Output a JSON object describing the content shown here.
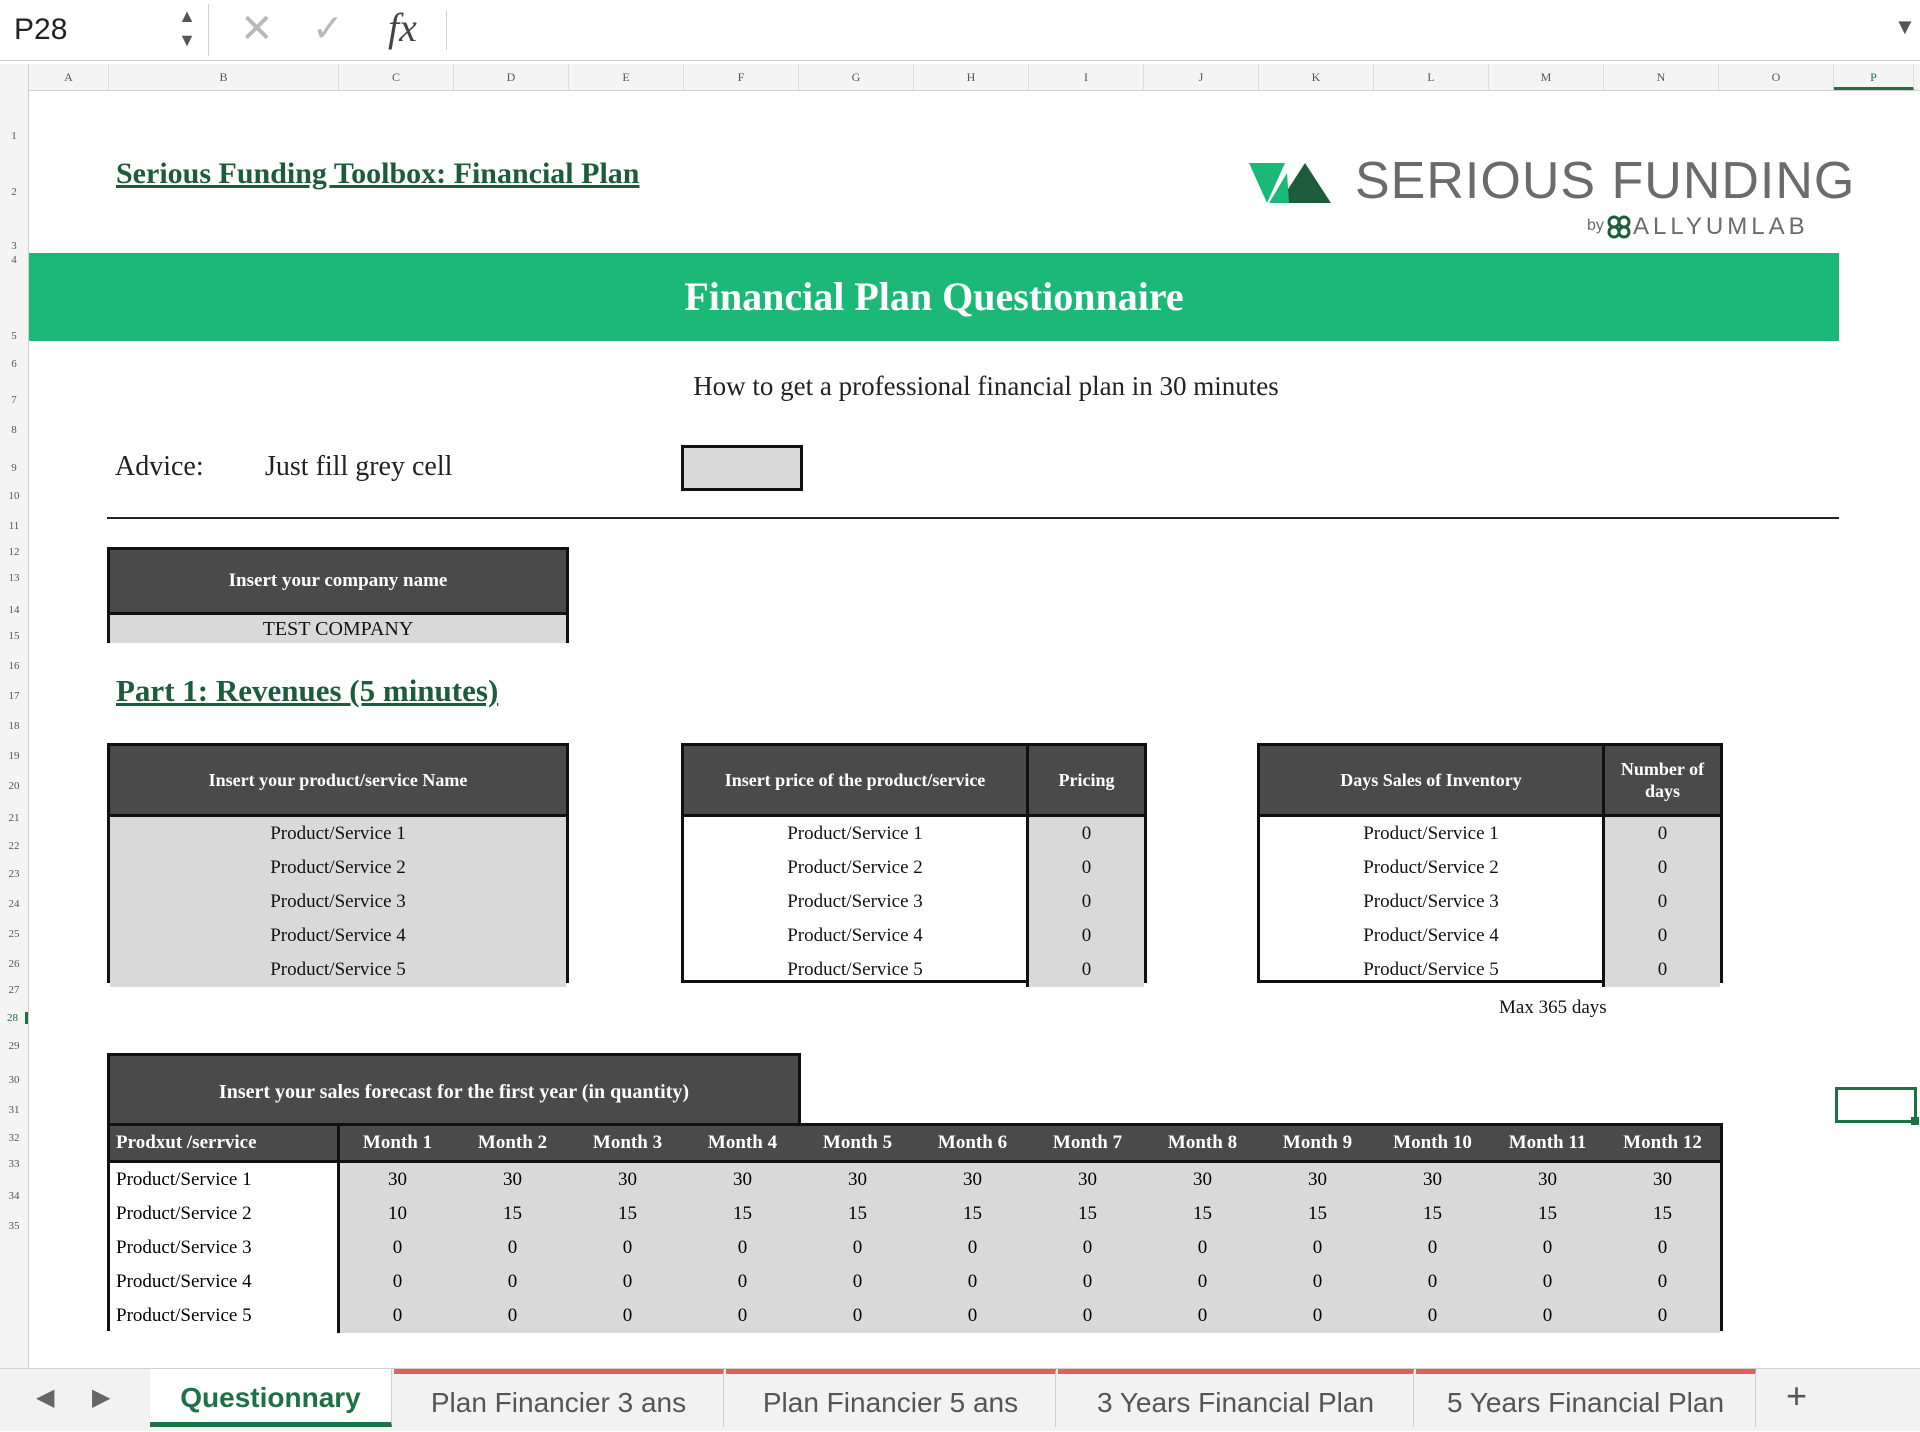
{
  "formula_bar": {
    "name_box": "P28",
    "cancel_icon": "✕",
    "enter_icon": "✓",
    "fx_label": "fx",
    "formula": ""
  },
  "columns": [
    "A",
    "B",
    "C",
    "D",
    "E",
    "F",
    "G",
    "H",
    "I",
    "J",
    "K",
    "L",
    "M",
    "N",
    "O",
    "P"
  ],
  "rows": [
    "1",
    "2",
    "3",
    "4",
    "5",
    "6",
    "7",
    "8",
    "9",
    "10",
    "11",
    "12",
    "13",
    "14",
    "15",
    "16",
    "17",
    "18",
    "19",
    "20",
    "21",
    "22",
    "23",
    "24",
    "25",
    "26",
    "27",
    "28",
    "29",
    "30",
    "31",
    "32",
    "33",
    "34",
    "35"
  ],
  "sheet": {
    "title": "Serious Funding Toolbox: Financial Plan",
    "logo": {
      "name": "SERIOUS FUNDING",
      "by": "by",
      "sub": "ALLYUMLAB"
    },
    "banner": "Financial Plan Questionnaire",
    "subtitle": "How to get a professional financial plan in 30 minutes",
    "advice_label": "Advice:",
    "advice_text": "Just fill grey cell",
    "company": {
      "header": "Insert your company name",
      "value": "TEST COMPANY"
    },
    "part1": "Part 1: Revenues (5 minutes)",
    "names_table": {
      "header": "Insert your product/service Name",
      "items": [
        "Product/Service 1",
        "Product/Service 2",
        "Product/Service 3",
        "Product/Service 4",
        "Product/Service 5"
      ]
    },
    "price_table": {
      "header": "Insert price of the product/service",
      "value_header": "Pricing",
      "rows": [
        {
          "name": "Product/Service 1",
          "value": "0"
        },
        {
          "name": "Product/Service 2",
          "value": "0"
        },
        {
          "name": "Product/Service 3",
          "value": "0"
        },
        {
          "name": "Product/Service 4",
          "value": "0"
        },
        {
          "name": "Product/Service 5",
          "value": "0"
        }
      ]
    },
    "inventory_table": {
      "header": "Days Sales of Inventory",
      "value_header": "Number of days",
      "rows": [
        {
          "name": "Product/Service 1",
          "value": "0"
        },
        {
          "name": "Product/Service 2",
          "value": "0"
        },
        {
          "name": "Product/Service 3",
          "value": "0"
        },
        {
          "name": "Product/Service 4",
          "value": "0"
        },
        {
          "name": "Product/Service 5",
          "value": "0"
        }
      ],
      "note": "Max 365 days"
    },
    "forecast": {
      "header": "Insert your sales forecast for the first year (in quantity)",
      "product_header": "Prodxut /serrvice",
      "months": [
        "Month 1",
        "Month 2",
        "Month 3",
        "Month 4",
        "Month 5",
        "Month 6",
        "Month 7",
        "Month 8",
        "Month 9",
        "Month 10",
        "Month 11",
        "Month 12"
      ],
      "rows": [
        {
          "name": "Product/Service 1",
          "values": [
            "30",
            "30",
            "30",
            "30",
            "30",
            "30",
            "30",
            "30",
            "30",
            "30",
            "30",
            "30"
          ]
        },
        {
          "name": "Product/Service 2",
          "values": [
            "10",
            "15",
            "15",
            "15",
            "15",
            "15",
            "15",
            "15",
            "15",
            "15",
            "15",
            "15"
          ]
        },
        {
          "name": "Product/Service 3",
          "values": [
            "0",
            "0",
            "0",
            "0",
            "0",
            "0",
            "0",
            "0",
            "0",
            "0",
            "0",
            "0"
          ]
        },
        {
          "name": "Product/Service 4",
          "values": [
            "0",
            "0",
            "0",
            "0",
            "0",
            "0",
            "0",
            "0",
            "0",
            "0",
            "0",
            "0"
          ]
        },
        {
          "name": "Product/Service 5",
          "values": [
            "0",
            "0",
            "0",
            "0",
            "0",
            "0",
            "0",
            "0",
            "0",
            "0",
            "0",
            "0"
          ]
        }
      ]
    }
  },
  "tabs": [
    "Questionnary",
    "Plan Financier 3 ans",
    "Plan Financier 5 ans",
    "3 Years Financial Plan",
    "5 Years Financial Plan"
  ],
  "colors": {
    "accent": "#1cb877",
    "dark_header": "#4a4a4a",
    "input_grey": "#d9d9d9",
    "link_green": "#1d5c3b",
    "tab_red": "#e06060"
  }
}
